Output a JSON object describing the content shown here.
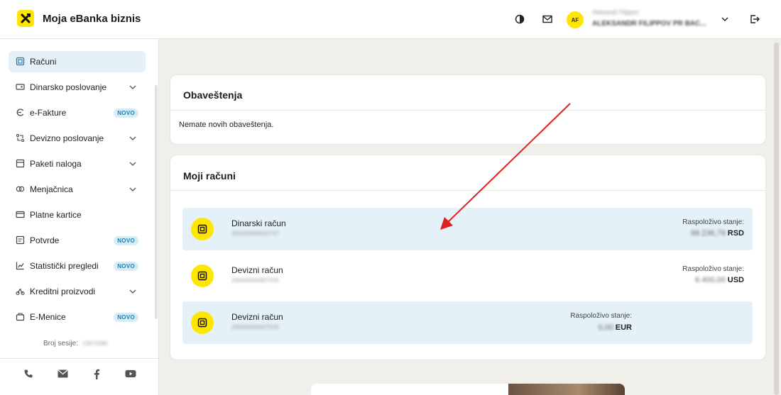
{
  "header": {
    "title": "Moja eBanka biznis",
    "user_initials": "AF",
    "user_name": "Aleksandr Filippov",
    "user_company": "ALEKSANDR FILIPPOV PR BAČ..."
  },
  "sidebar": {
    "items": [
      {
        "label": "Računi",
        "icon": "accounts-icon",
        "active": true
      },
      {
        "label": "Dinarsko poslovanje",
        "icon": "dinar-icon",
        "chevron": true
      },
      {
        "label": "e-Fakture",
        "icon": "e-invoice-icon",
        "badge": "NOVO"
      },
      {
        "label": "Devizno poslovanje",
        "icon": "foreign-currency-icon",
        "chevron": true
      },
      {
        "label": "Paketi naloga",
        "icon": "packages-icon",
        "chevron": true
      },
      {
        "label": "Menjačnica",
        "icon": "exchange-icon",
        "chevron": true
      },
      {
        "label": "Platne kartice",
        "icon": "card-icon"
      },
      {
        "label": "Potvrde",
        "icon": "confirmations-icon",
        "badge": "NOVO"
      },
      {
        "label": "Statistički pregledi",
        "icon": "statistics-icon",
        "badge": "NOVO"
      },
      {
        "label": "Kreditni proizvodi",
        "icon": "credit-icon",
        "chevron": true
      },
      {
        "label": "E-Menice",
        "icon": "e-menice-icon",
        "badge": "NOVO"
      }
    ],
    "session_label": "Broj sesije:",
    "session_value": "12672290",
    "footer_icons": [
      "phone-icon",
      "mail-icon",
      "facebook-icon",
      "youtube-icon"
    ]
  },
  "notifications": {
    "title": "Obaveštenja",
    "empty_text": "Nemate novih obaveštenja."
  },
  "accounts": {
    "title": "Moji računi",
    "balance_label": "Raspoloživo stanje:",
    "list": [
      {
        "name": "Dinarski račun",
        "number": "265000000000797",
        "amount": "98.236,79",
        "currency": "RSD"
      },
      {
        "name": "Devizni račun",
        "number": "265000000907026",
        "amount": "6.400,00",
        "currency": "USD"
      },
      {
        "name": "Devizni račun",
        "number": "265000000907026",
        "amount": "0,00",
        "currency": "EUR"
      }
    ]
  },
  "colors": {
    "brand_yellow": "#fee600",
    "highlight_blue": "#e4f1f8",
    "badge_text": "#1b7fb0",
    "background": "#f1efea",
    "annotation_arrow": "#e02020"
  }
}
